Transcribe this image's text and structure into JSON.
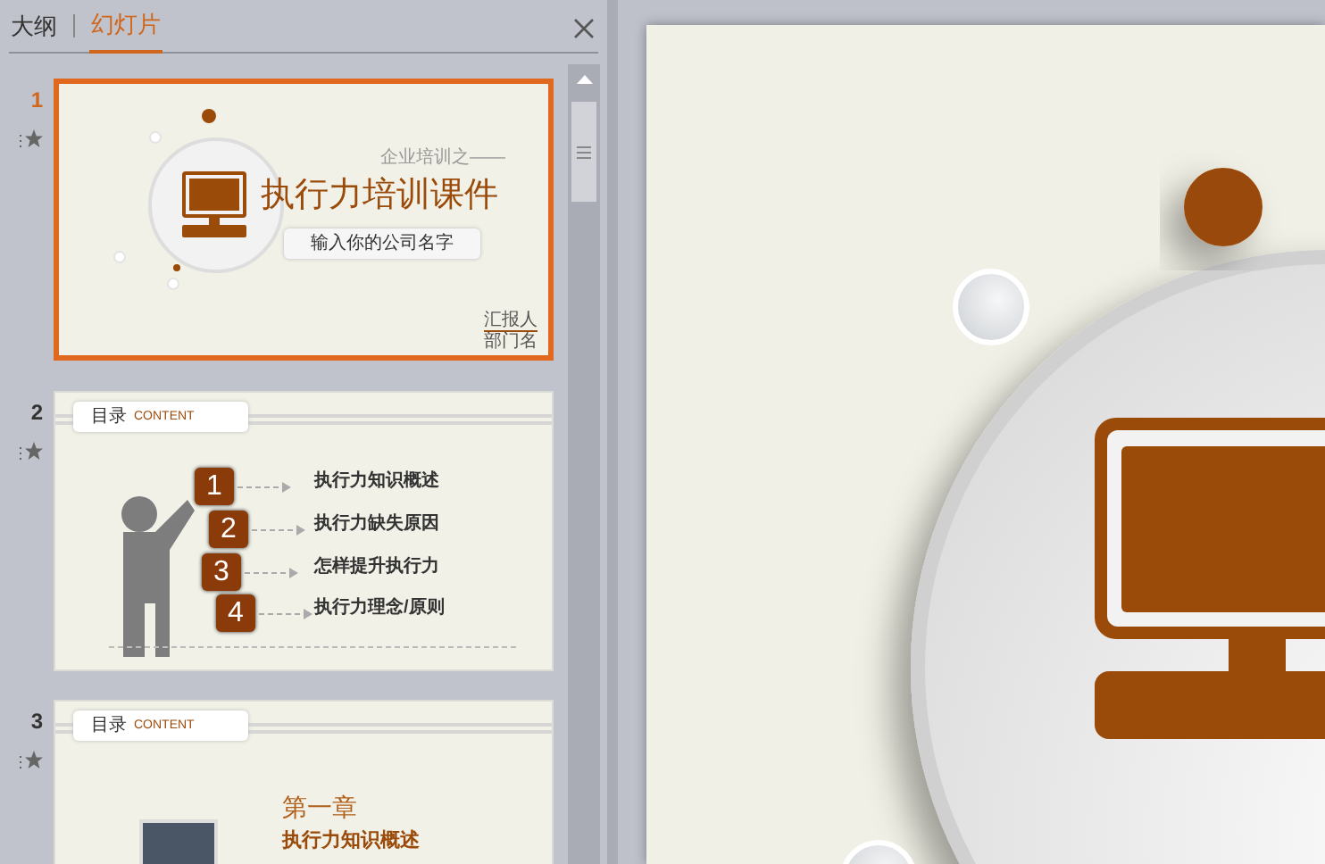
{
  "panel_tabs": [
    {
      "label": "大纲",
      "selected": false
    },
    {
      "label": "幻灯片",
      "selected": true
    }
  ],
  "slides": [
    {
      "number": "1",
      "selected": true,
      "kind": "title",
      "subtitle": "企业培训之——",
      "title": "执行力培训课件",
      "company_field": "输入你的公司名字",
      "presenter": "汇报人",
      "department": "部门名"
    },
    {
      "number": "2",
      "selected": false,
      "kind": "agenda",
      "header": "目录",
      "header_en": "CONTENT",
      "items": [
        {
          "number": "1",
          "text": "执行力知识概述"
        },
        {
          "number": "2",
          "text": "执行力缺失原因"
        },
        {
          "number": "3",
          "text": "怎样提升执行力"
        },
        {
          "number": "4",
          "text": "执行力理念/原则"
        }
      ]
    },
    {
      "number": "3",
      "selected": false,
      "kind": "chapter",
      "header": "目录",
      "header_en": "CONTENT",
      "chapter": "第一章",
      "chapter_title": "执行力知识概述"
    }
  ]
}
